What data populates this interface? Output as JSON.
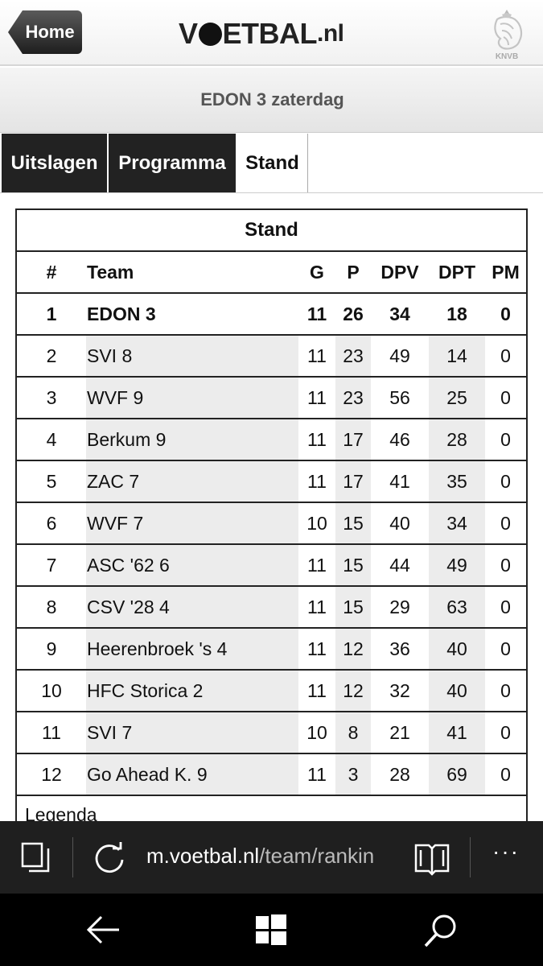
{
  "header": {
    "home_label": "Home",
    "logo_left": "V",
    "logo_right": "ETBAL",
    "logo_suffix": ".nl",
    "knvb_label": "KNVB"
  },
  "team_title": "EDON 3 zaterdag",
  "tabs": [
    {
      "label": "Uitslagen",
      "active": false
    },
    {
      "label": "Programma",
      "active": false
    },
    {
      "label": "Stand",
      "active": true
    }
  ],
  "standing": {
    "title": "Stand",
    "columns": [
      "#",
      "Team",
      "G",
      "P",
      "DPV",
      "DPT",
      "PM"
    ],
    "rows": [
      [
        "1",
        "EDON 3",
        "11",
        "26",
        "34",
        "18",
        "0"
      ],
      [
        "2",
        "SVI 8",
        "11",
        "23",
        "49",
        "14",
        "0"
      ],
      [
        "3",
        "WVF 9",
        "11",
        "23",
        "56",
        "25",
        "0"
      ],
      [
        "4",
        "Berkum 9",
        "11",
        "17",
        "46",
        "28",
        "0"
      ],
      [
        "5",
        "ZAC 7",
        "11",
        "17",
        "41",
        "35",
        "0"
      ],
      [
        "6",
        "WVF 7",
        "10",
        "15",
        "40",
        "34",
        "0"
      ],
      [
        "7",
        "ASC '62 6",
        "11",
        "15",
        "44",
        "49",
        "0"
      ],
      [
        "8",
        "CSV '28 4",
        "11",
        "15",
        "29",
        "63",
        "0"
      ],
      [
        "9",
        "Heerenbroek 's 4",
        "11",
        "12",
        "36",
        "40",
        "0"
      ],
      [
        "10",
        "HFC Storica 2",
        "11",
        "12",
        "32",
        "40",
        "0"
      ],
      [
        "11",
        "SVI 7",
        "10",
        "8",
        "21",
        "41",
        "0"
      ],
      [
        "12",
        "Go Ahead K. 9",
        "11",
        "3",
        "28",
        "69",
        "0"
      ]
    ],
    "legend_label": "Legenda"
  },
  "browser": {
    "url_host": "m.voetbal.nl",
    "url_path": "/team/rankin",
    "more_label": "···"
  },
  "colors": {
    "tab_dark": "#222222",
    "browser_bar": "#1f1f1f",
    "nav_bar": "#000000",
    "alt_column": "#ececec"
  }
}
